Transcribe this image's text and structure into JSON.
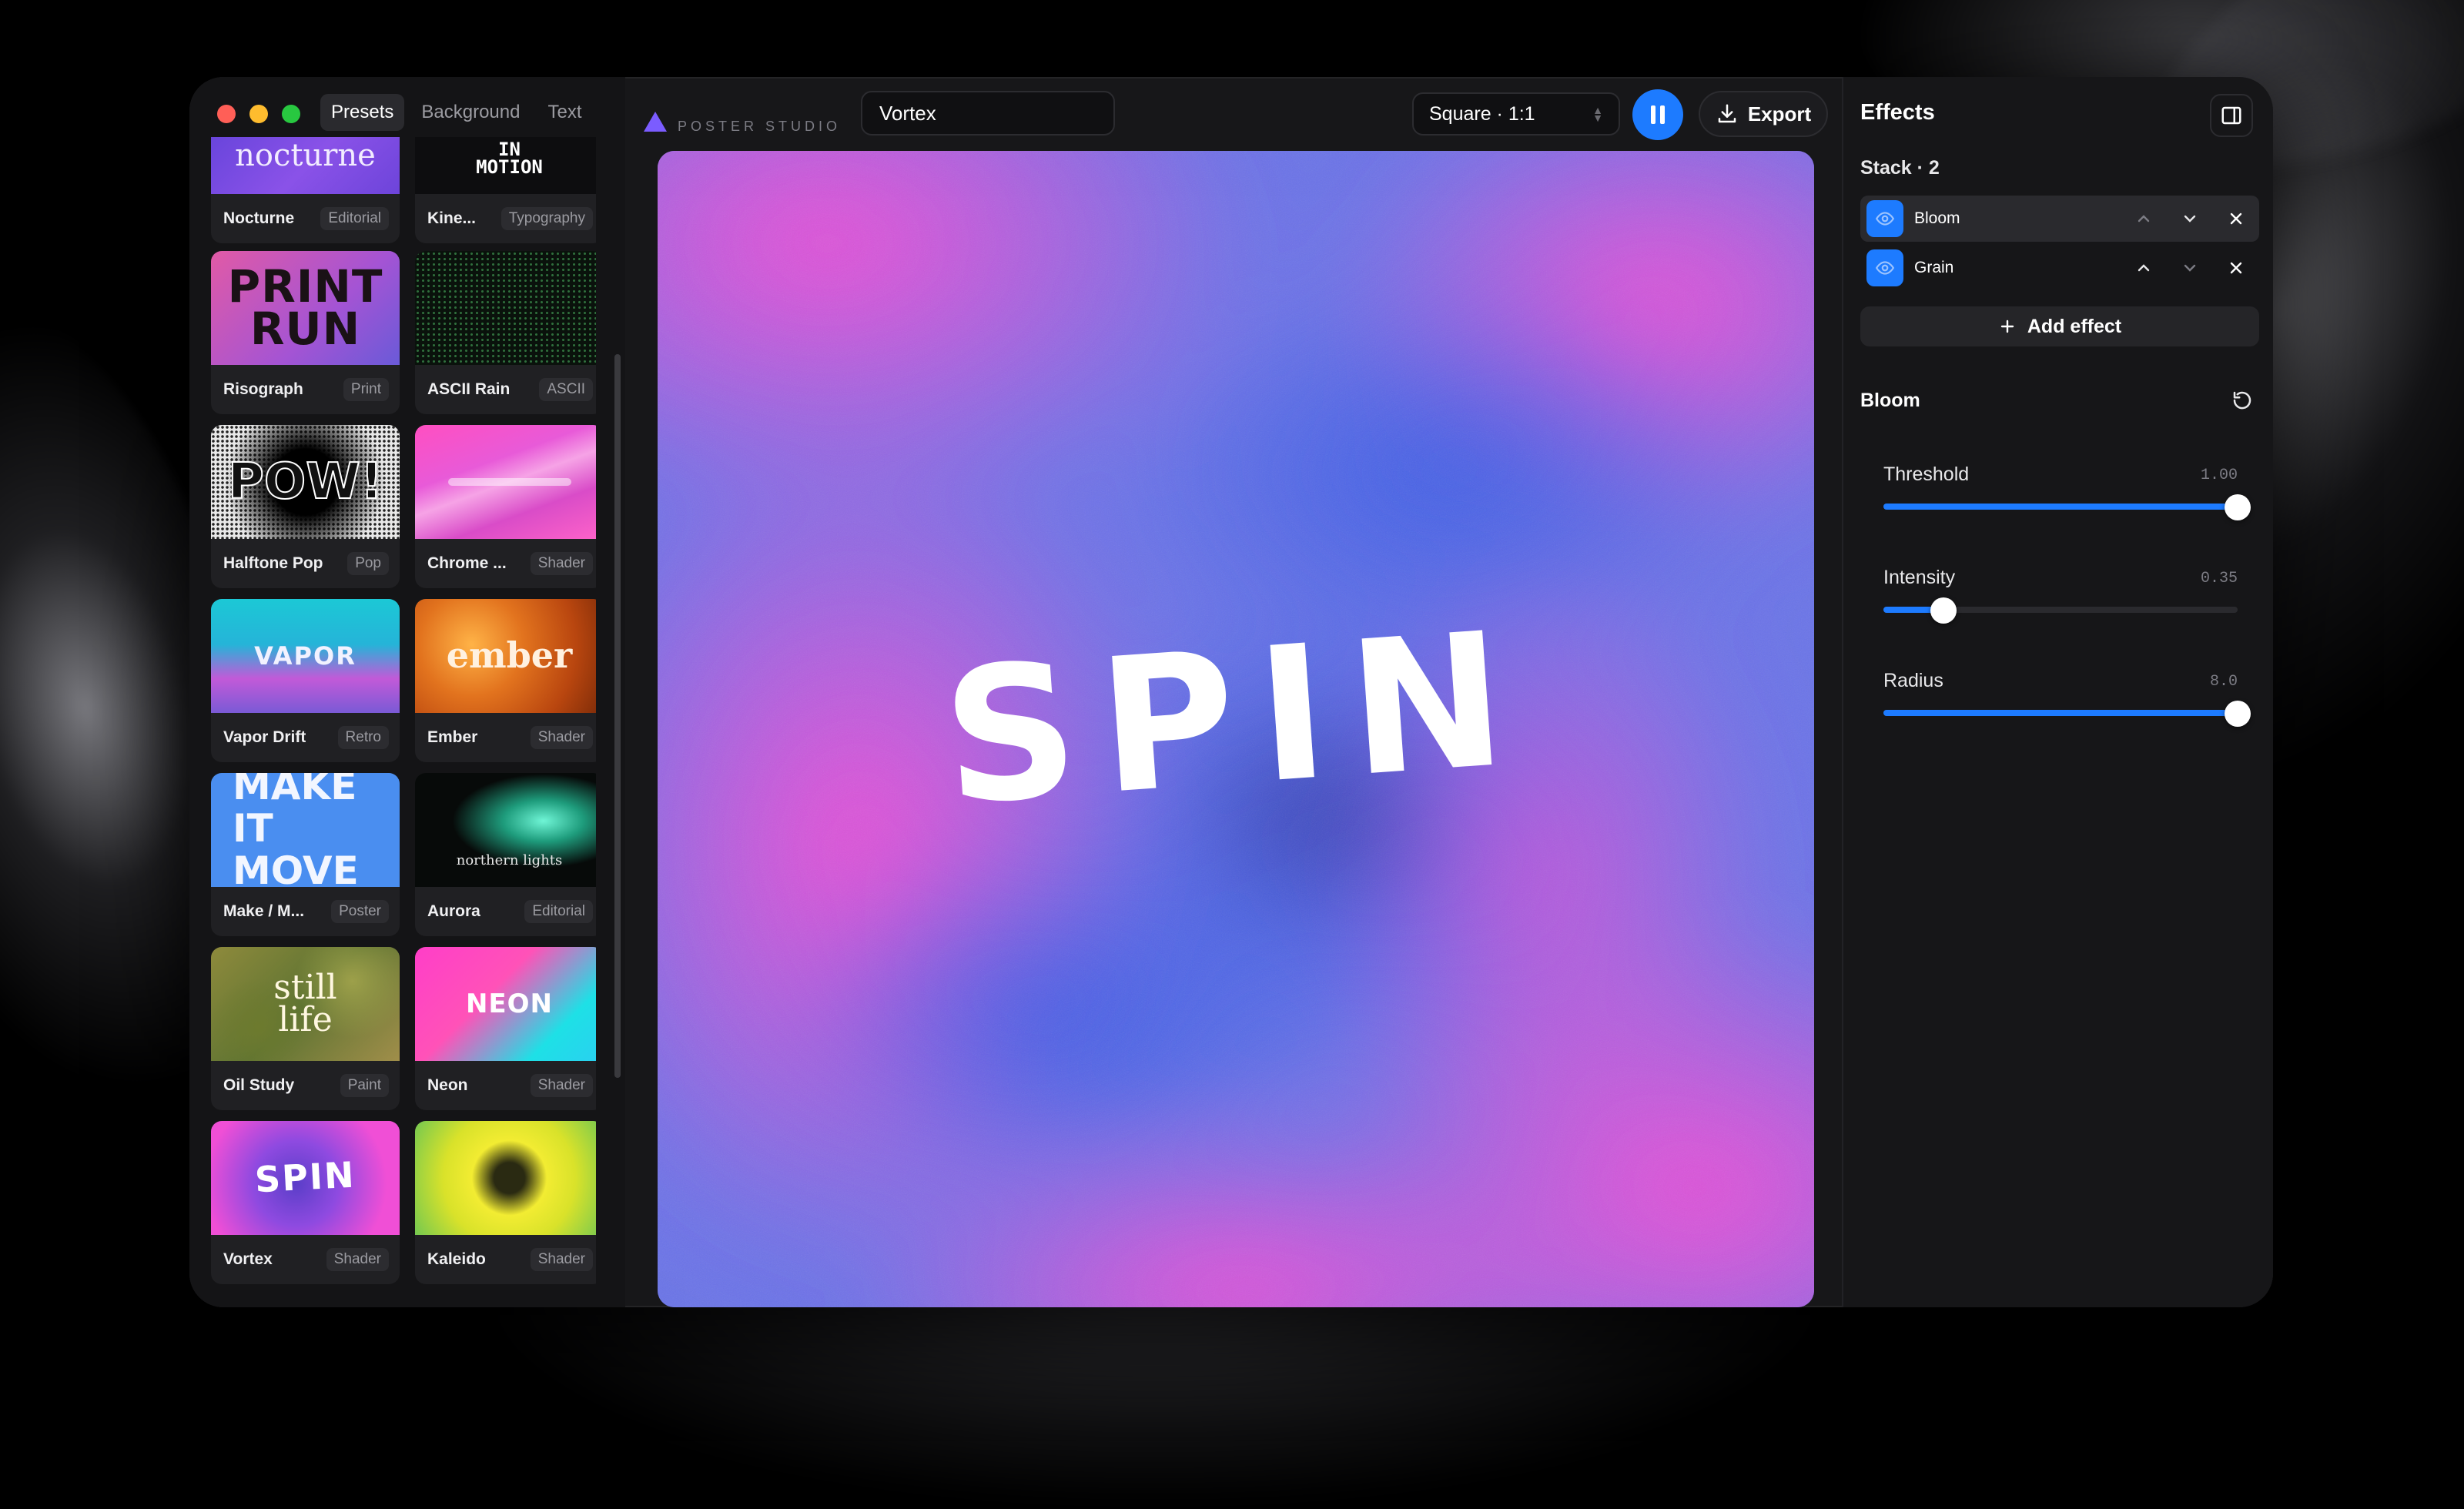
{
  "window": {
    "app_name": "POSTER STUDIO"
  },
  "sidebar": {
    "tabs": [
      {
        "label": "Presets",
        "active": true
      },
      {
        "label": "Background",
        "active": false
      },
      {
        "label": "Text",
        "active": false
      }
    ],
    "presets": [
      {
        "name": "Nocturne",
        "tag": "Editorial",
        "thumb_text": "nocturne"
      },
      {
        "name": "Kine...",
        "tag": "Typography",
        "thumb_text": "IN MOTION"
      },
      {
        "name": "Risograph",
        "tag": "Print",
        "thumb_text": "PRINT RUN"
      },
      {
        "name": "ASCII Rain",
        "tag": "ASCII",
        "thumb_text": ""
      },
      {
        "name": "Halftone Pop",
        "tag": "Pop",
        "thumb_text": "POW!"
      },
      {
        "name": "Chrome ...",
        "tag": "Shader",
        "thumb_text": ""
      },
      {
        "name": "Vapor Drift",
        "tag": "Retro",
        "thumb_text": "VAPOR"
      },
      {
        "name": "Ember",
        "tag": "Shader",
        "thumb_text": "ember"
      },
      {
        "name": "Make / M...",
        "tag": "Poster",
        "thumb_text": "MAKE IT MOVE"
      },
      {
        "name": "Aurora",
        "tag": "Editorial",
        "thumb_text": "northern lights"
      },
      {
        "name": "Oil Study",
        "tag": "Paint",
        "thumb_text": "still life"
      },
      {
        "name": "Neon",
        "tag": "Shader",
        "thumb_text": "NEON"
      },
      {
        "name": "Vortex",
        "tag": "Shader",
        "thumb_text": "SPIN"
      },
      {
        "name": "Kaleido",
        "tag": "Shader",
        "thumb_text": ""
      }
    ]
  },
  "toolbar": {
    "name_value": "Vortex",
    "aspect_label": "Square · 1:1",
    "export_label": "Export"
  },
  "canvas": {
    "text": "SPIN"
  },
  "effects": {
    "title": "Effects",
    "stack_label": "Stack · 2",
    "stack": [
      {
        "name": "Bloom",
        "selected": true
      },
      {
        "name": "Grain",
        "selected": false
      }
    ],
    "add_label": "Add effect",
    "selected_effect": "Bloom",
    "params": [
      {
        "label": "Threshold",
        "value": "1.00",
        "fraction": 1.0
      },
      {
        "label": "Intensity",
        "value": "0.35",
        "fraction": 0.17
      },
      {
        "label": "Radius",
        "value": "8.0",
        "fraction": 1.0
      }
    ]
  },
  "colors": {
    "accent": "#1d7bff",
    "canvas_pink": "#f04fd6",
    "canvas_blue": "#5a6ee8"
  }
}
